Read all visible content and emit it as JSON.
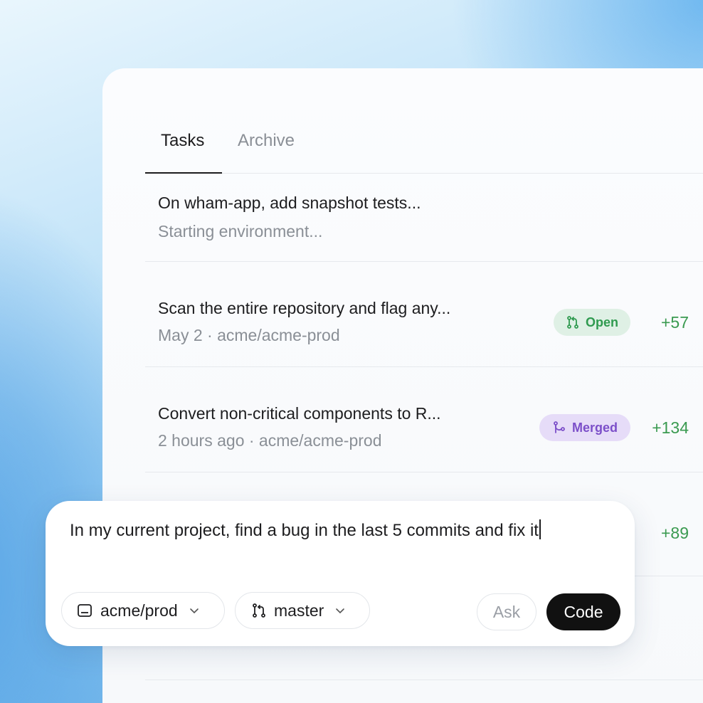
{
  "tabs": [
    {
      "label": "Tasks",
      "active": true
    },
    {
      "label": "Archive",
      "active": false
    }
  ],
  "tasks": [
    {
      "title": "On wham-app, add snapshot tests...",
      "subtitle": "Starting environment..."
    },
    {
      "title": "Scan the entire repository and flag any...",
      "subtitle": "May 2 · acme/acme-prod",
      "status": "Open",
      "delta": "+57"
    },
    {
      "title": "Convert non-critical components to R...",
      "subtitle": "2 hours ago · acme/acme-prod",
      "status": "Merged",
      "delta": "+134"
    },
    {
      "delta": "+89"
    }
  ],
  "composer": {
    "prompt": "In my current project, find a bug in the last 5 commits and fix it",
    "repo": "acme/prod",
    "branch": "master",
    "ask_label": "Ask",
    "code_label": "Code"
  },
  "icons": {
    "repo": "terminal-window-icon",
    "branch": "git-branch-icon",
    "open": "pull-request-icon",
    "merged": "merge-icon",
    "chevron": "chevron-down-icon"
  },
  "colors": {
    "open_badge_bg": "#dff0e5",
    "open_badge_text": "#2f9a4f",
    "merged_badge_bg": "#e6dcf8",
    "merged_badge_text": "#7c4fc9",
    "delta_green": "#3a9a50",
    "code_button_bg": "#111111"
  }
}
